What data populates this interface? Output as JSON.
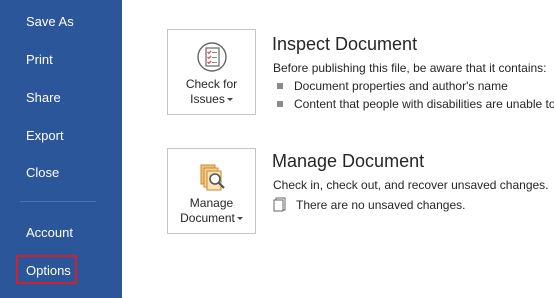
{
  "sidebar": {
    "items": [
      {
        "label": "Save As"
      },
      {
        "label": "Print"
      },
      {
        "label": "Share"
      },
      {
        "label": "Export"
      },
      {
        "label": "Close"
      },
      {
        "label": "Account"
      },
      {
        "label": "Options"
      }
    ],
    "highlighted_item": "Options",
    "highlight_color": "#d2202f",
    "background_color": "#2b579a"
  },
  "inspect": {
    "tile_line1": "Check for",
    "tile_line2": "Issues",
    "tile_icon": "inspect-checklist-icon",
    "title": "Inspect Document",
    "description": "Before publishing this file, be aware that it contains:",
    "bullets": [
      "Document properties and author's name",
      "Content that people with disabilities are unable to"
    ]
  },
  "manage": {
    "tile_line1": "Manage",
    "tile_line2": "Document",
    "tile_icon": "manage-document-search-icon",
    "title": "Manage Document",
    "description": "Check in, check out, and recover unsaved changes.",
    "status": "There are no unsaved changes."
  }
}
